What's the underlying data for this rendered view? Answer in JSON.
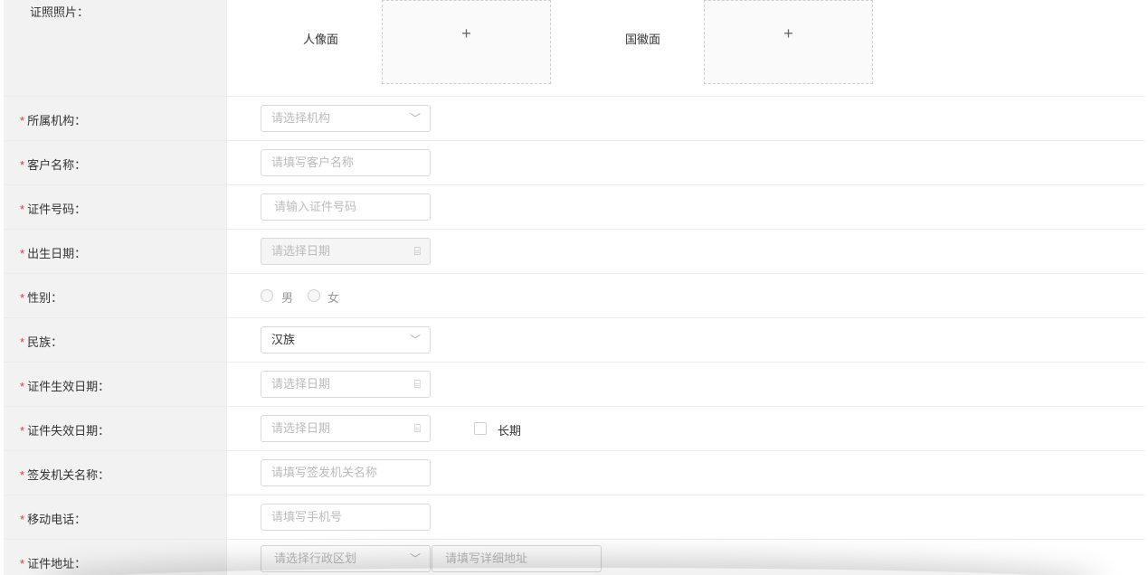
{
  "photo": {
    "label": "证照照片：",
    "front_label": "人像面",
    "back_label": "国徽面",
    "plus": "+"
  },
  "required_star": "*",
  "fields": {
    "org": {
      "label": "所属机构：",
      "placeholder": "请选择机构",
      "suffix": "﹀"
    },
    "name": {
      "label": "客户名称：",
      "placeholder": "请填写客户名称"
    },
    "idno": {
      "label": "证件号码：",
      "placeholder": "请输入证件号码"
    },
    "birth": {
      "label": "出生日期：",
      "placeholder": "请选择日期",
      "suffix": "⌸"
    },
    "gender": {
      "label": "性别：",
      "male": "男",
      "female": "女"
    },
    "ethnic": {
      "label": "民族：",
      "value": "汉族",
      "suffix": "﹀"
    },
    "valid_from": {
      "label": "证件生效日期：",
      "placeholder": "请选择日期",
      "suffix": "⌸"
    },
    "valid_to": {
      "label": "证件失效日期：",
      "placeholder": "请选择日期",
      "suffix": "⌸",
      "long_term": "长期"
    },
    "issuer": {
      "label": "签发机关名称：",
      "placeholder": "请填写签发机关名称"
    },
    "mobile": {
      "label": "移动电话：",
      "placeholder": "请填写手机号"
    },
    "address": {
      "label": "证件地址：",
      "region_placeholder": "请选择行政区划",
      "detail_placeholder": "请填写详细地址",
      "suffix": "﹀"
    }
  }
}
